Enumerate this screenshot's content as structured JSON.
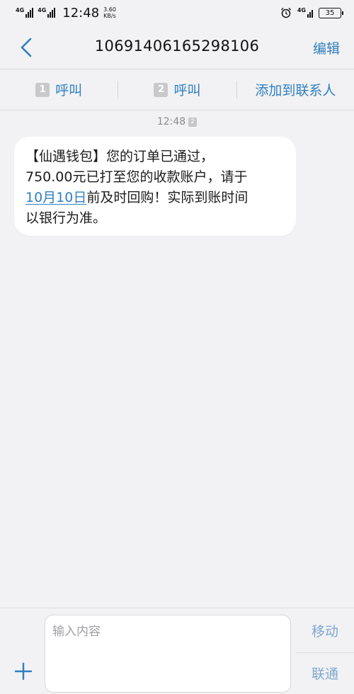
{
  "status_bar": {
    "sim1_network": "4G",
    "sim2_network": "4G",
    "time": "12:48",
    "speed_value": "3.60",
    "speed_unit": "KB/s",
    "right_network": "4G",
    "battery": "35"
  },
  "header": {
    "title": "10691406165298106",
    "edit_label": "编辑"
  },
  "actions": {
    "call_sim1_badge": "1",
    "call_sim1_label": "呼叫",
    "call_sim2_badge": "2",
    "call_sim2_label": "呼叫",
    "add_contact_label": "添加到联系人"
  },
  "message": {
    "time": "12:48",
    "sim_badge": "2",
    "line1": "【仙遇钱包】您的订单已通过，",
    "line2": "750.00元已打至您的收款账户，请于",
    "date_link": "10月10日",
    "line3_rest": "前及时回购！实际到账时间",
    "line4": "以银行为准。"
  },
  "composer": {
    "placeholder": "输入内容",
    "send_sim1_label": "移动",
    "send_sim2_label": "联通"
  },
  "colors": {
    "accent": "#2f7fc1",
    "background": "#f2f2f4",
    "bubble": "#ffffff"
  }
}
